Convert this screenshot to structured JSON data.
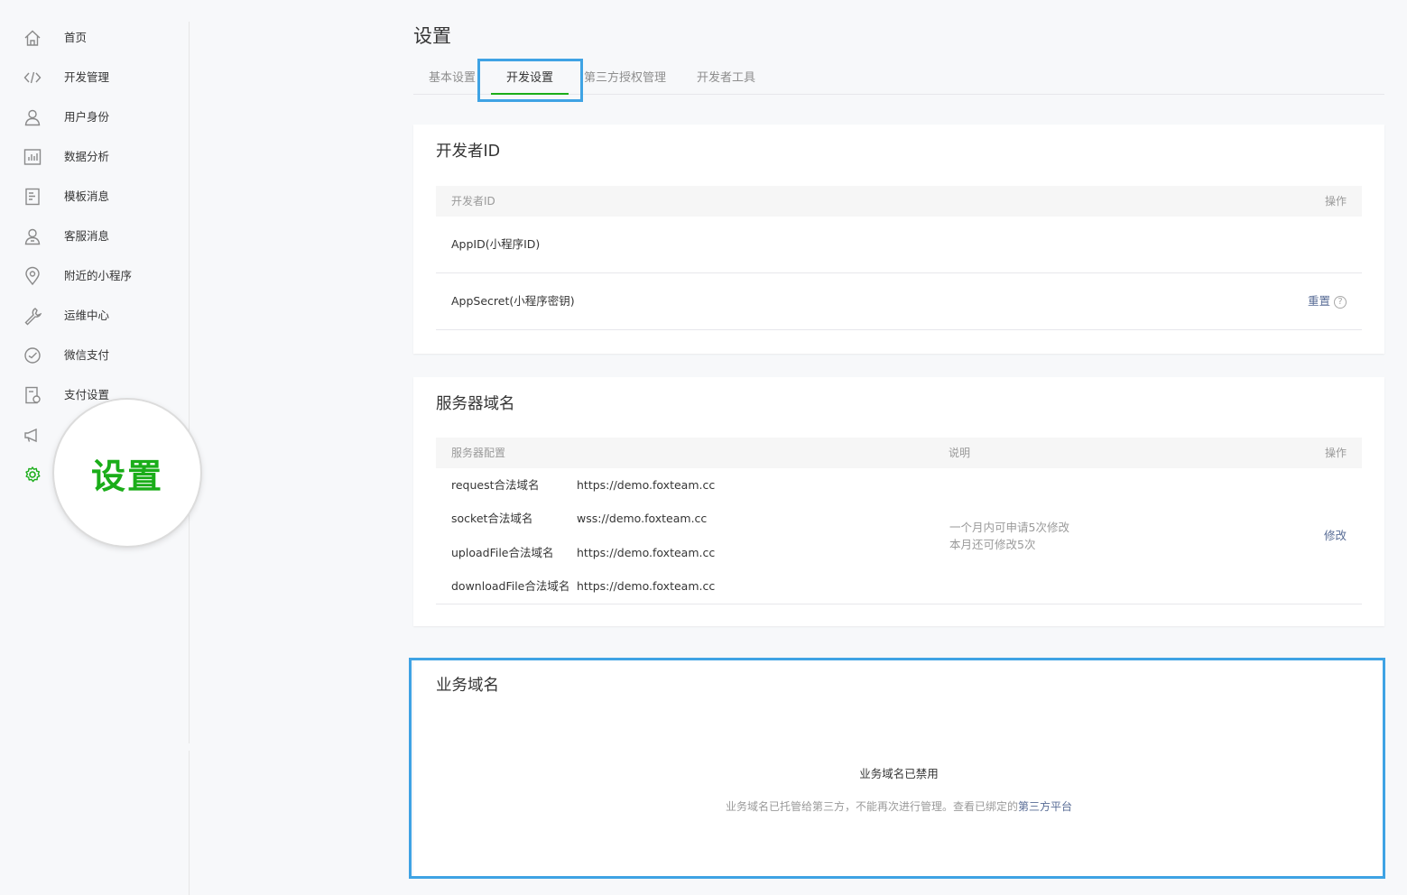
{
  "sidebar": {
    "items": [
      {
        "label": "首页",
        "icon": "home-icon"
      },
      {
        "label": "开发管理",
        "icon": "code-icon"
      },
      {
        "label": "用户身份",
        "icon": "user-icon"
      },
      {
        "label": "数据分析",
        "icon": "chart-icon"
      },
      {
        "label": "模板消息",
        "icon": "document-icon"
      },
      {
        "label": "客服消息",
        "icon": "service-icon"
      },
      {
        "label": "附近的小程序",
        "icon": "location-pin-icon"
      },
      {
        "label": "运维中心",
        "icon": "wrench-icon"
      },
      {
        "label": "微信支付",
        "icon": "payment-icon"
      },
      {
        "label": "支付设置",
        "icon": "payment-settings-icon"
      },
      {
        "label": "",
        "icon": "megaphone-icon"
      },
      {
        "label": "",
        "icon": "gear-icon"
      }
    ],
    "magnifier_label": "设置",
    "active_color": "#1aad19"
  },
  "header": {
    "title": "设置"
  },
  "tabs": [
    {
      "label": "基本设置"
    },
    {
      "label": "开发设置",
      "active": true
    },
    {
      "label": "第三方授权管理"
    },
    {
      "label": "开发者工具"
    }
  ],
  "developer_id": {
    "title": "开发者ID",
    "columns": {
      "left": "开发者ID",
      "right": "操作"
    },
    "rows": [
      {
        "name": "AppID(小程序ID)",
        "action": ""
      },
      {
        "name": "AppSecret(小程序密钥)",
        "action": "重置",
        "help": "?"
      }
    ]
  },
  "server_domains": {
    "title": "服务器域名",
    "columns": {
      "config": "服务器配置",
      "desc": "说明",
      "action": "操作"
    },
    "rows": [
      {
        "name": "request合法域名",
        "value": "https://demo.foxteam.cc"
      },
      {
        "name": "socket合法域名",
        "value": "wss://demo.foxteam.cc"
      },
      {
        "name": "uploadFile合法域名",
        "value": "https://demo.foxteam.cc"
      },
      {
        "name": "downloadFile合法域名",
        "value": "https://demo.foxteam.cc"
      }
    ],
    "desc_line1": "一个月内可申请5次修改",
    "desc_line2": "本月还可修改5次",
    "action": "修改"
  },
  "business_domain": {
    "title": "业务域名",
    "status": "业务域名已禁用",
    "note": "业务域名已托管给第三方，不能再次进行管理。查看已绑定的",
    "link": "第三方平台"
  },
  "colors": {
    "accent": "#1aad19",
    "highlight": "#3fa3e4",
    "link": "#576b95"
  }
}
